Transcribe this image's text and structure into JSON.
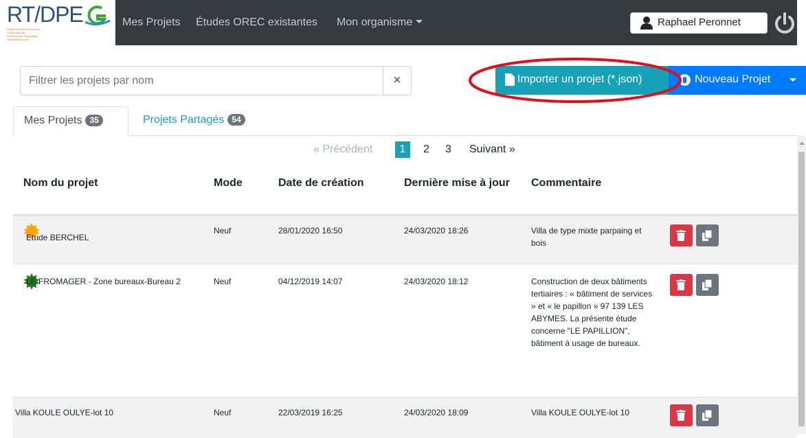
{
  "brand": {
    "name": "RT/DPE",
    "subtitle": "Réglementation Thermique / Diagnostic de Performance Énergétique Guadeloupe 2020"
  },
  "nav": {
    "links": [
      "Mes Projets",
      "Études OREC existantes",
      "Mon organisme"
    ],
    "user_name": "Raphael Peronnet"
  },
  "toolbar": {
    "search_placeholder": "Filtrer les projets par nom",
    "clear_label": "×",
    "import_label": "Importer un projet (*.json)",
    "new_label": "Nouveau Projet"
  },
  "tabs": [
    {
      "label": "Mes Projets",
      "count": "35",
      "active": true
    },
    {
      "label": "Projets Partagés",
      "count": "54",
      "active": false
    }
  ],
  "pagination": {
    "prev": "« Précédent",
    "pages": [
      "1",
      "2",
      "3"
    ],
    "current": "1",
    "next": "Suivant »"
  },
  "table": {
    "headers": [
      "Nom du projet",
      "Mode",
      "Date de création",
      "Dernière mise à jour",
      "Commentaire"
    ],
    "rows": [
      {
        "name": "Etude BERCHEL",
        "status_icon": "orange-star-badge-icon",
        "status_color": "#ffa500",
        "mode": "Neuf",
        "created": "28/01/2020 16:50",
        "updated": "24/03/2020 18:26",
        "comment": "Villa de type mixte parpaing et bois"
      },
      {
        "name": "LE FROMAGER - Zone bureaux-Bureau 2",
        "status_icon": "green-star-badge-icon",
        "status_color": "#1e7b1e",
        "mode": "Neuf",
        "created": "04/12/2019 14:07",
        "updated": "24/03/2020 18:12",
        "comment": "Construction de deux bâtiments tertiaires : « bâtiment de services » et « le papillon » 97 139 LES ABYMES. La présente étude concerne \"LE PAPILLION\", bâtiment à usage de bureaux."
      },
      {
        "name": "Villa KOULE OULYE-lot 10",
        "status_icon": "",
        "mode": "Neuf",
        "created": "22/03/2019 16:25",
        "updated": "24/03/2020 18:09",
        "comment": "Villa KOULE OULYE-lot 10"
      }
    ]
  },
  "colors": {
    "navbar": "#343a40",
    "import": "#17a2b8",
    "primary": "#007bff",
    "danger": "#dc3545",
    "secondary": "#6c757d",
    "annotation": "#e0101a"
  }
}
